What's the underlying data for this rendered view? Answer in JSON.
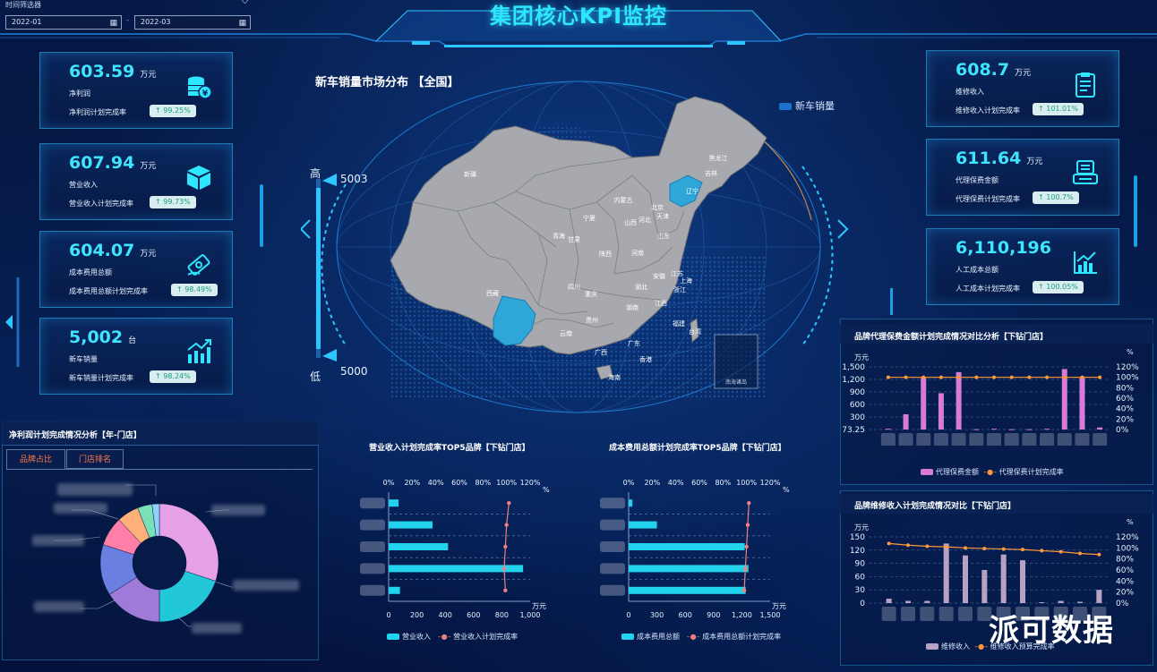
{
  "header": {
    "title": "集团核心KPI监控",
    "filter_label": "时间筛选器",
    "date_start": "2022-01",
    "date_end": "2022-03"
  },
  "kpi_left": [
    {
      "value": "603.59",
      "unit": "万元",
      "name": "净利润",
      "rate_label": "净利润计划完成率",
      "rate": "↑ 99.25%",
      "icon": "coins-icon"
    },
    {
      "value": "607.94",
      "unit": "万元",
      "name": "营业收入",
      "rate_label": "营业收入计划完成率",
      "rate": "↑ 99.73%",
      "icon": "box-icon"
    },
    {
      "value": "604.07",
      "unit": "万元",
      "name": "成本费用总额",
      "rate_label": "成本费用总额计划完成率",
      "rate": "↑ 98.49%",
      "icon": "money-icon"
    },
    {
      "value": "5,002",
      "unit": "台",
      "name": "新车销量",
      "rate_label": "新车销量计划完成率",
      "rate": "↑ 98.24%",
      "icon": "bar-trend-icon"
    }
  ],
  "kpi_right": [
    {
      "value": "608.7",
      "unit": "万元",
      "name": "维修收入",
      "rate_label": "维修收入计划完成率",
      "rate": "↑ 101.01%",
      "icon": "clipboard-icon"
    },
    {
      "value": "611.64",
      "unit": "万元",
      "name": "代理保费金额",
      "rate_label": "代理保费计划完成率",
      "rate": "↑ 100.7%",
      "icon": "register-icon"
    },
    {
      "value": "6,110,196",
      "unit": "",
      "name": "人工成本总额",
      "rate_label": "人工成本计划完成率",
      "rate": "↑ 100.05%",
      "icon": "chart-up-icon"
    }
  ],
  "map": {
    "title": "新车销量市场分布 【全国】",
    "legend": "新车销量",
    "scale_high_label": "高",
    "scale_low_label": "低",
    "scale_max": "5003",
    "scale_min": "5000",
    "provinces": [
      "新疆",
      "西藏",
      "青海",
      "甘肃",
      "内蒙古",
      "宁夏",
      "陕西",
      "四川",
      "重庆",
      "云南",
      "贵州",
      "广西",
      "广东",
      "香港",
      "海南",
      "湖南",
      "湖北",
      "河南",
      "山西",
      "河北",
      "北京",
      "天津",
      "山东",
      "江苏",
      "安徽",
      "上海",
      "浙江",
      "江西",
      "福建",
      "台湾",
      "辽宁",
      "吉林",
      "黑龙江"
    ],
    "highlighted": [
      "辽宁",
      "云南"
    ],
    "inset_label": "南海诸岛"
  },
  "panel_net_profit": {
    "title": "净利润计划完成情况分析【年-门店】",
    "tabs": [
      "品牌占比",
      "门店排名"
    ]
  },
  "chart_revenue_top5": {
    "title": "营业收入计划完成率TOP5品牌【下钻门店】",
    "legend": [
      "营业收入",
      "营业收入计划完成率"
    ],
    "unit_right": "万元",
    "unit_top": "%"
  },
  "chart_cost_top5": {
    "title": "成本费用总额计划完成率TOP5品牌【下钻门店】",
    "legend": [
      "成本费用总额",
      "成本费用总额计划完成率"
    ],
    "unit_right": "万元",
    "unit_top": "%"
  },
  "chart_insurance": {
    "title": "品牌代理保费金额计划完成情况对比分析【下钻门店】",
    "legend": [
      "代理保费金额",
      "代理保费计划完成率"
    ],
    "unit_left": "万元",
    "unit_right": "%"
  },
  "chart_repair": {
    "title": "品牌维修收入计划完成情况对比【下钻门店】",
    "legend": [
      "维修收入",
      "维修收入预算完成率"
    ],
    "unit_left": "万元",
    "unit_right": "%"
  },
  "watermark": "派可数据",
  "chart_data": [
    {
      "type": "bar",
      "title": "营业收入计划完成率TOP5品牌【下钻门店】",
      "orientation": "horizontal",
      "x_ticks": [
        "0",
        "200",
        "400",
        "600",
        "800",
        "1,000"
      ],
      "top_ticks": [
        "0%",
        "20%",
        "40%",
        "60%",
        "80%",
        "100%",
        "120%"
      ],
      "xlim": [
        0,
        1000
      ],
      "top_lim": [
        0,
        120
      ],
      "series": [
        {
          "name": "营业收入",
          "values": [
            70,
            310,
            420,
            950,
            80
          ]
        },
        {
          "name": "营业收入计划完成率",
          "values": [
            102,
            100,
            99,
            98,
            99
          ]
        }
      ]
    },
    {
      "type": "bar",
      "title": "成本费用总额计划完成率TOP5品牌【下钻门店】",
      "orientation": "horizontal",
      "x_ticks": [
        "0",
        "300",
        "600",
        "900",
        "1,200",
        "1,500"
      ],
      "top_ticks": [
        "0%",
        "20%",
        "40%",
        "60%",
        "80%",
        "100%",
        "120%"
      ],
      "xlim": [
        0,
        1500
      ],
      "top_lim": [
        0,
        120
      ],
      "series": [
        {
          "name": "成本费用总额",
          "values": [
            40,
            300,
            1230,
            1270,
            1240
          ]
        },
        {
          "name": "成本费用总额计划完成率",
          "values": [
            102,
            101,
            100,
            99,
            98
          ]
        }
      ]
    },
    {
      "type": "bar",
      "title": "品牌代理保费金额计划完成情况对比分析【下钻门店】",
      "y_ticks": [
        "73.25",
        "300",
        "600",
        "900",
        "1,200",
        "1,500"
      ],
      "y2_ticks": [
        "0%",
        "20%",
        "40%",
        "60%",
        "80%",
        "100%",
        "120%"
      ],
      "ylim": [
        73.25,
        1500
      ],
      "y2lim": [
        0,
        120
      ],
      "series": [
        {
          "name": "代理保费金额",
          "values": [
            90,
            420,
            1250,
            900,
            1380,
            80,
            90,
            80,
            80,
            90,
            1450,
            1250,
            120
          ]
        },
        {
          "name": "代理保费计划完成率",
          "values": [
            100,
            100,
            100,
            100,
            100,
            100,
            100,
            100,
            100,
            100,
            100,
            100,
            100
          ]
        }
      ]
    },
    {
      "type": "bar",
      "title": "品牌维修收入计划完成情况对比【下钻门店】",
      "y_ticks": [
        "0",
        "30",
        "60",
        "90",
        "120",
        "150"
      ],
      "y2_ticks": [
        "0%",
        "20%",
        "40%",
        "60%",
        "80%",
        "100%",
        "120%"
      ],
      "ylim": [
        0,
        150
      ],
      "y2lim": [
        0,
        120
      ],
      "series": [
        {
          "name": "维修收入",
          "values": [
            10,
            5,
            5,
            135,
            108,
            75,
            110,
            97,
            2,
            5,
            3,
            30
          ]
        },
        {
          "name": "维修收入预算完成率",
          "values": [
            108,
            105,
            103,
            102,
            100,
            99,
            98,
            97,
            95,
            93,
            90,
            88
          ]
        }
      ]
    },
    {
      "type": "pie",
      "title": "净利润计划完成情况分析【年-门店】",
      "values": [
        30,
        20,
        16,
        14,
        8,
        6,
        4,
        2
      ],
      "colors": [
        "#e6a0e6",
        "#22c7d8",
        "#a07ad8",
        "#6b7fe0",
        "#ff7fa8",
        "#ffb07a",
        "#7ae0b8",
        "#8fd0ff"
      ]
    }
  ]
}
